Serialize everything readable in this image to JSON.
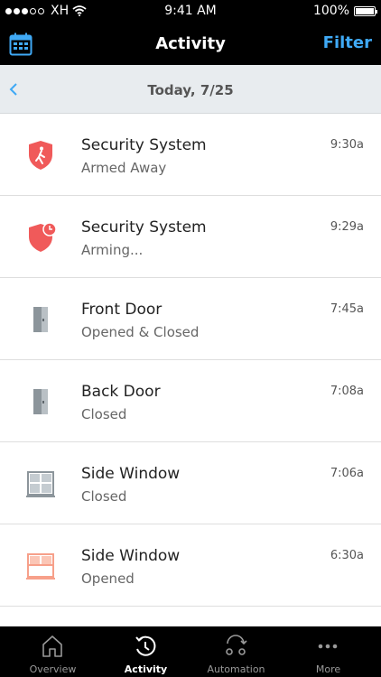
{
  "status_bar": {
    "carrier": "XH",
    "time": "9:41 AM",
    "battery": "100%"
  },
  "header": {
    "title": "Activity",
    "filter_label": "Filter"
  },
  "date_bar": {
    "label": "Today, 7/25"
  },
  "events": [
    {
      "title": "Security System",
      "status": "Armed Away",
      "time": "9:30a",
      "icon": "shield-armed-away-icon"
    },
    {
      "title": "Security System",
      "status": "Arming...",
      "time": "9:29a",
      "icon": "shield-arming-clock-icon"
    },
    {
      "title": "Front Door",
      "status": "Opened & Closed",
      "time": "7:45a",
      "icon": "door-icon"
    },
    {
      "title": "Back Door",
      "status": "Closed",
      "time": "7:08a",
      "icon": "door-icon"
    },
    {
      "title": "Side Window",
      "status": "Closed",
      "time": "7:06a",
      "icon": "window-closed-icon"
    },
    {
      "title": "Side Window",
      "status": "Opened",
      "time": "6:30a",
      "icon": "window-opened-icon"
    }
  ],
  "tabs": [
    {
      "label": "Overview",
      "icon": "home-icon",
      "active": false
    },
    {
      "label": "Activity",
      "icon": "activity-clock-icon",
      "active": true
    },
    {
      "label": "Automation",
      "icon": "automation-icon",
      "active": false
    },
    {
      "label": "More",
      "icon": "more-dots-icon",
      "active": false
    }
  ],
  "colors": {
    "accent": "#3fa9f5",
    "alert": "#f05a5a",
    "window_open": "#f7a08a",
    "icon_gray": "#8c959b"
  }
}
